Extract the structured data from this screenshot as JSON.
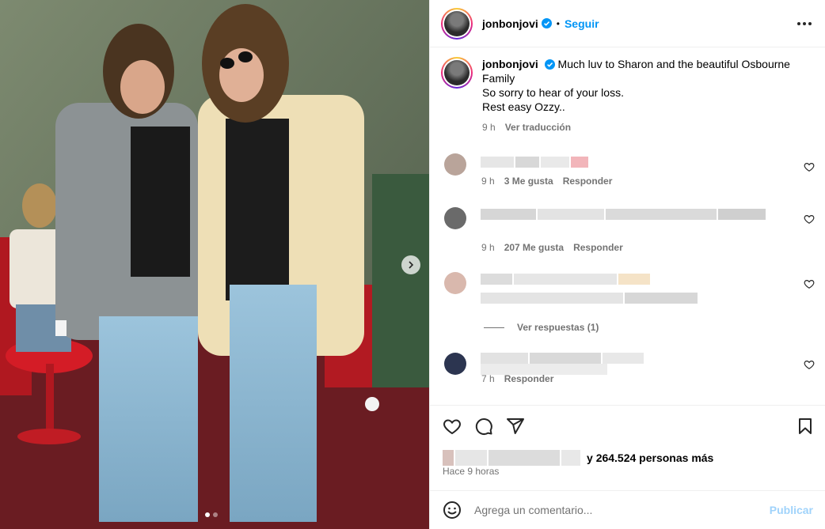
{
  "post": {
    "username": "jonbonjovi",
    "verified": true,
    "follow_label": "Seguir",
    "bullet": "•"
  },
  "caption": {
    "username": "jonbonjovi",
    "lines": [
      "Much luv to Sharon and the beautiful Osbourne Family",
      "So sorry to hear of your loss.",
      "Rest easy Ozzy.."
    ],
    "time": "9 h",
    "translate_label": "Ver traducción"
  },
  "comments": [
    {
      "time": "9 h",
      "likes": "3 Me gusta",
      "reply": "Responder"
    },
    {
      "time": "9 h",
      "likes": "207 Me gusta",
      "reply": "Responder"
    },
    {
      "view_replies": "Ver respuestas (1)"
    },
    {
      "time": "7 h",
      "reply": "Responder"
    }
  ],
  "carousel": {
    "slides": 2,
    "current": 1
  },
  "likes": {
    "suffix": "264.524 personas más",
    "prefix_char": "y"
  },
  "posted": "Hace 9 horas",
  "add_comment": {
    "placeholder": "Agrega un comentario...",
    "publish_label": "Publicar"
  },
  "icons": {
    "more": "more-options-icon",
    "like": "heart-icon",
    "comment": "comment-icon",
    "share": "share-icon",
    "save": "bookmark-icon",
    "emoji": "emoji-icon",
    "next": "chevron-right-icon"
  },
  "colors": {
    "accent": "#0095f6",
    "muted": "#737373",
    "publish_disabled": "#a0d3fb"
  }
}
